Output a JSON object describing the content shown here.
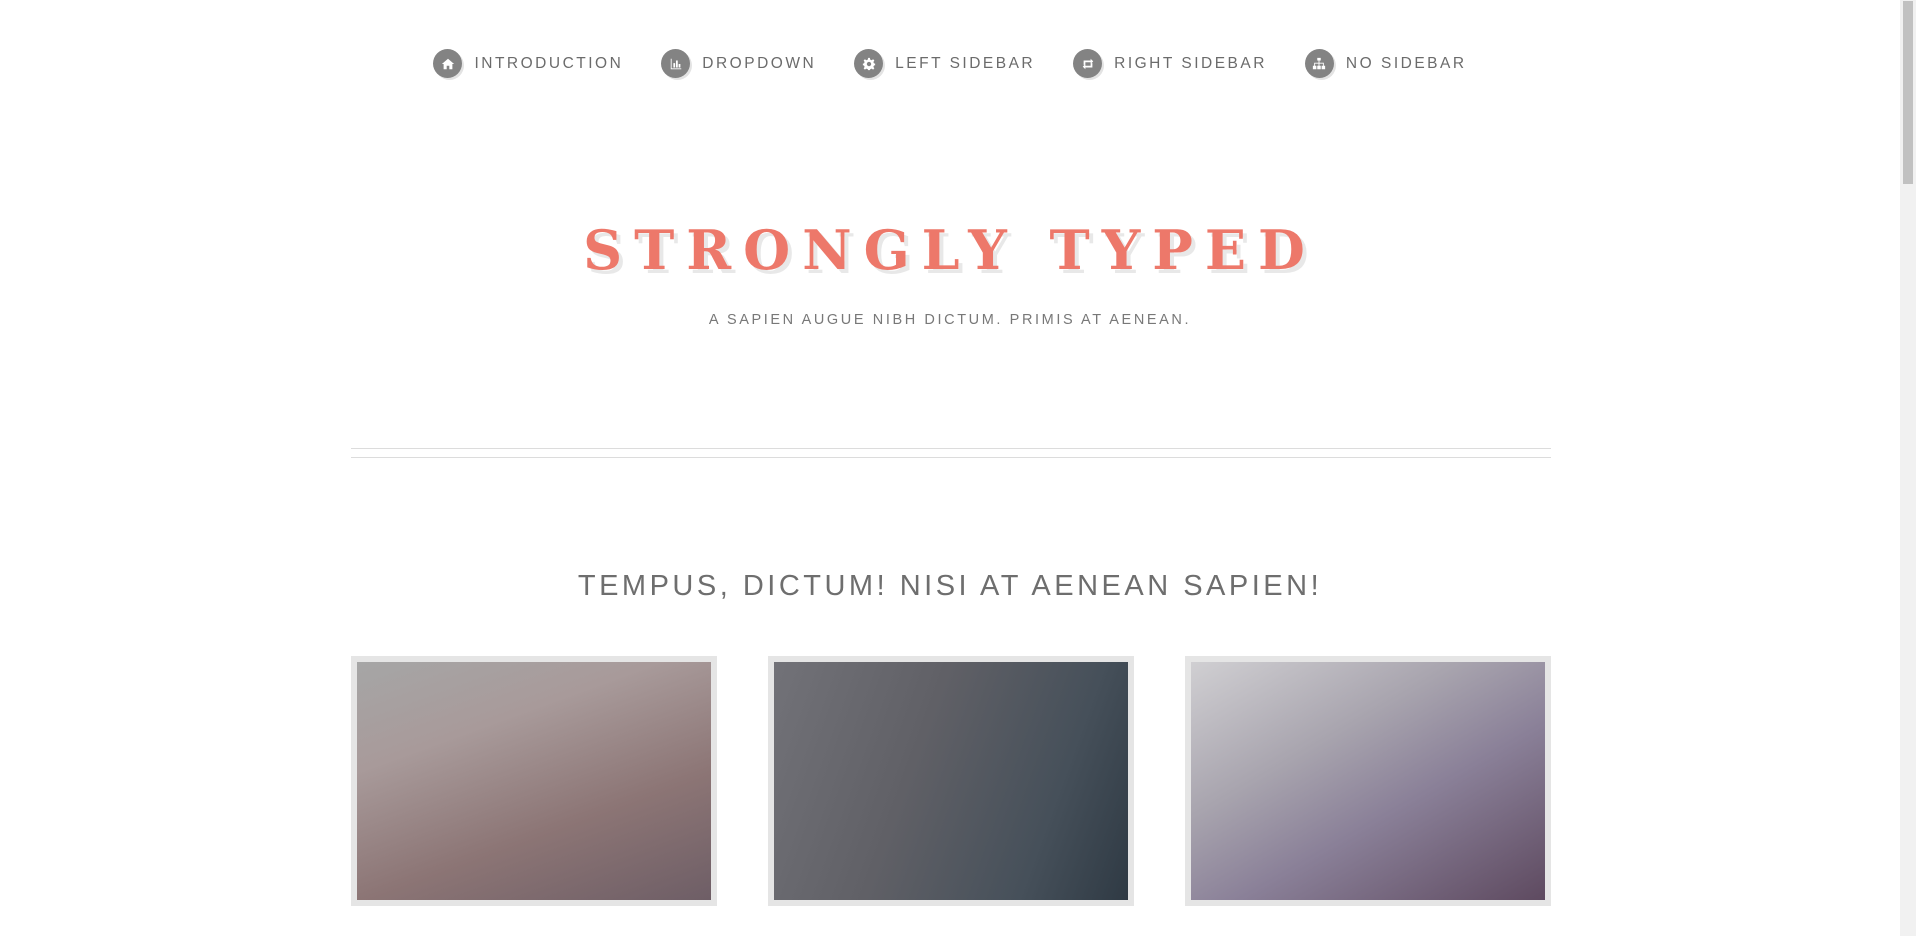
{
  "nav": {
    "items": [
      {
        "label": "INTRODUCTION",
        "icon": "home-icon"
      },
      {
        "label": "DROPDOWN",
        "icon": "bar-chart-icon"
      },
      {
        "label": "LEFT SIDEBAR",
        "icon": "gear-icon"
      },
      {
        "label": "RIGHT SIDEBAR",
        "icon": "retweet-icon"
      },
      {
        "label": "NO SIDEBAR",
        "icon": "sitemap-icon"
      }
    ]
  },
  "header": {
    "title": "STRONGLY TYPED",
    "tagline": "A SAPIEN AUGUE NIBH DICTUM. PRIMIS AT AENEAN."
  },
  "section": {
    "heading": "TEMPUS, DICTUM! NISI AT AENEAN SAPIEN!"
  },
  "colors": {
    "accent": "#ed786a",
    "nav_icon_bg": "#838383",
    "text_muted": "#6b6b6b"
  }
}
